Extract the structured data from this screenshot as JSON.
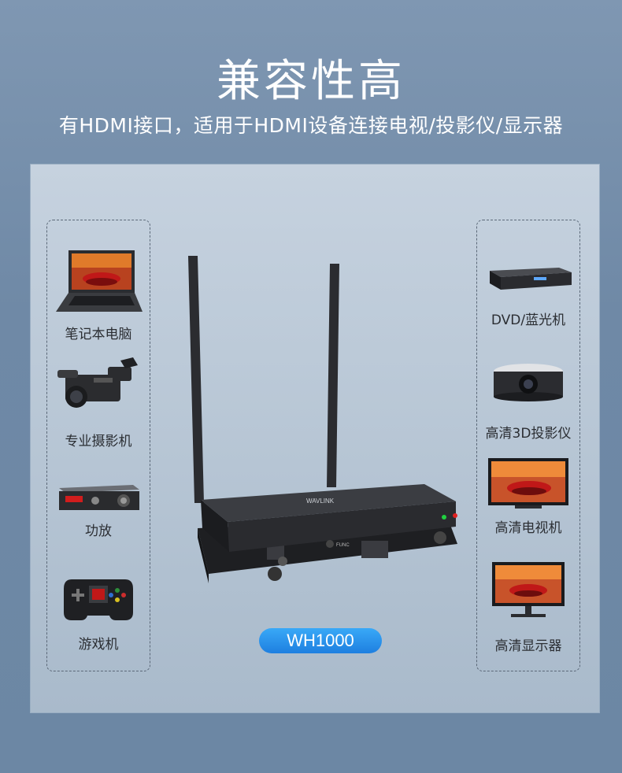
{
  "header": {
    "title": "兼容性高",
    "subtitle": "有HDMI接口，适用于HDMI设备连接电视/投影仪/显示器"
  },
  "left_devices": [
    {
      "label": "笔记本电脑",
      "icon": "laptop-icon"
    },
    {
      "label": "专业摄影机",
      "icon": "camcorder-icon"
    },
    {
      "label": "功放",
      "icon": "amplifier-icon"
    },
    {
      "label": "游戏机",
      "icon": "gamepad-icon"
    }
  ],
  "right_devices": [
    {
      "label": "DVD/蓝光机",
      "icon": "dvd-player-icon"
    },
    {
      "label": "高清3D投影仪",
      "icon": "projector-icon"
    },
    {
      "label": "高清电视机",
      "icon": "tv-icon"
    },
    {
      "label": "高清显示器",
      "icon": "monitor-icon"
    }
  ],
  "product": {
    "model": "WH1000",
    "brand": "WAVLINK",
    "button_label": "FUNC"
  },
  "colors": {
    "badge": "#2a93ee",
    "background": "#7891ad",
    "panel": "#bccad8"
  }
}
